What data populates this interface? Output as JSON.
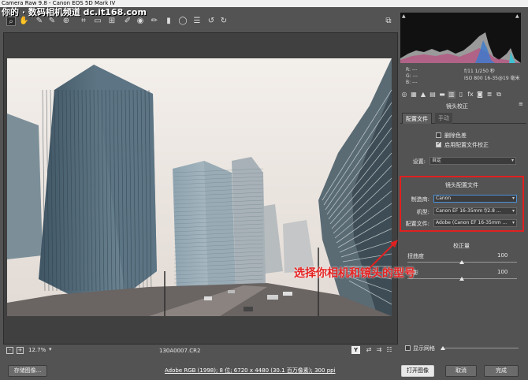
{
  "window": {
    "title": "Camera Raw 9.8 - Canon EOS 5D Mark IV"
  },
  "watermark": {
    "text": "你的 · 数码相机频道 dc.it168.com"
  },
  "toolbar": {
    "tools": [
      "zoom-tool",
      "hand-tool",
      "white-balance-tool",
      "color-sampler-tool",
      "targeted-adjustment-tool",
      "crop-tool",
      "straighten-tool",
      "transform-tool",
      "spot-removal-tool",
      "red-eye-tool",
      "adjustment-brush",
      "graduated-filter",
      "radial-filter",
      "preferences",
      "rotate-ccw",
      "rotate-cw"
    ],
    "fullscreen_icon": "fullscreen-icon"
  },
  "preview": {
    "zoom": "12.7%",
    "filename": "130A0007.CR2"
  },
  "footer": {
    "save_label": "存储图像...",
    "workflow_link": "Adobe RGB (1998); 8 位; 6720 x 4480 (30.1 百万像素); 300 ppi",
    "open_label": "打开图像",
    "cancel_label": "取消",
    "done_label": "完成"
  },
  "histogram": {
    "rgb": {
      "r": "R:  ---",
      "g": "G:  ---",
      "b": "B:  ---"
    },
    "exif": {
      "aperture_shutter": "f/11   1/250 秒",
      "iso_lens": "ISO 800   16-35@19 毫米"
    }
  },
  "lens_panel": {
    "title": "镜头校正",
    "tab_profile": "配置文件",
    "tab_manual": "手动",
    "remove_ca_label": "删除色差",
    "remove_ca_checked": false,
    "enable_profile_label": "启用配置文件校正",
    "enable_profile_checked": true,
    "setup_label": "设置:",
    "setup_value": "自定",
    "profile_section_title": "镜头配置文件",
    "make_label": "制造商:",
    "make_value": "Canon",
    "model_label": "机型:",
    "model_value": "Canon EF 16-35mm f/2.8 ...",
    "profile_label": "配置文件:",
    "profile_value": "Adobe (Canon EF 16-35mm ...",
    "amount_title": "校正量",
    "distortion_label": "扭曲度",
    "distortion_value": "100",
    "vignetting_label": "晕影",
    "vignetting_value": "100",
    "show_grid_label": "显示网格"
  },
  "annotation": {
    "text": "选择你相机和镜头的型号",
    "color": "#e52222"
  },
  "colors": {
    "ui_bg": "#535353",
    "highlight": "#e02020"
  }
}
